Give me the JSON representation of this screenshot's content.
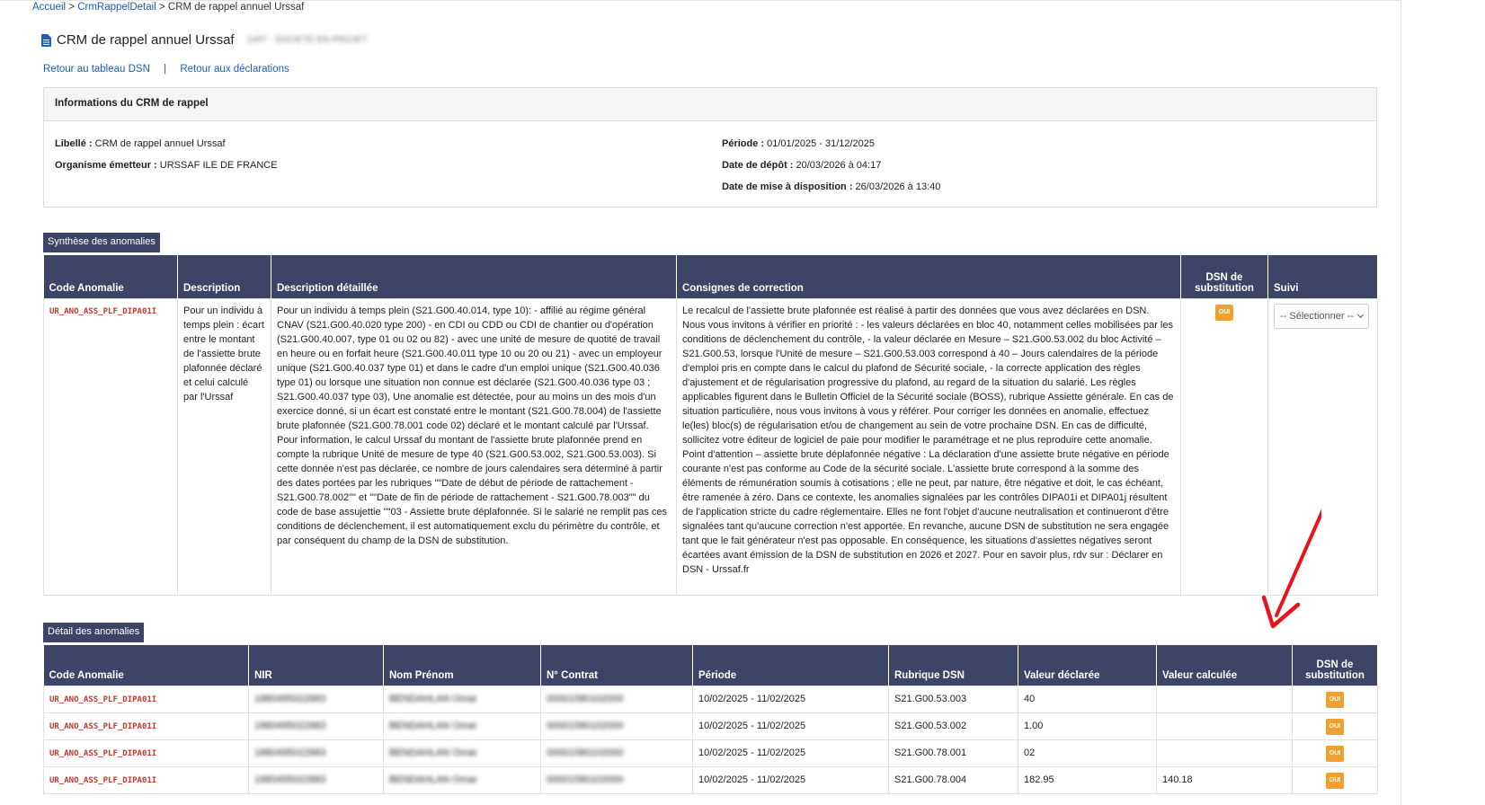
{
  "breadcrumb": {
    "home": "Accueil",
    "section": "CrmRappelDetail",
    "current": "CRM de rappel annuel Urssaf",
    "sep": ">"
  },
  "page": {
    "title": "CRM de rappel annuel Urssaf",
    "subtitle_blurred": "1407 - SOCIETE EN PROJET"
  },
  "links": {
    "back_dsn": "Retour au tableau DSN",
    "separator": "|",
    "back_declarations": "Retour aux déclarations"
  },
  "info": {
    "header": "Informations du CRM de rappel",
    "libelle_label": "Libellé :",
    "libelle_value": "CRM de rappel annuel Urssaf",
    "organisme_label": "Organisme émetteur :",
    "organisme_value": "URSSAF ILE DE FRANCE",
    "periode_label": "Période :",
    "periode_value": "01/01/2025 - 31/12/2025",
    "depot_label": "Date de dépôt :",
    "depot_value": "20/03/2026 à 04:17",
    "dispo_label": "Date de mise à disposition :",
    "dispo_value": "26/03/2026 à 13:40"
  },
  "synthese": {
    "label": "Synthèse des anomalies",
    "headers": {
      "code": "Code Anomalie",
      "description": "Description",
      "detail": "Description détaillée",
      "consignes": "Consignes de correction",
      "dsn": "DSN de substitution",
      "suivi": "Suivi"
    },
    "row": {
      "code": "UR_ANO_ASS_PLF_DIPA01I",
      "description": "Pour un individu à temps plein : écart entre le montant de l'assiette brute plafonnée déclaré et celui calculé par l'Urssaf",
      "detail": "Pour un individu à temps plein (S21.G00.40.014, type 10): - affilié au régime général CNAV (S21.G00.40.020 type 200) - en CDI ou CDD ou CDI de chantier ou d'opération (S21.G00.40.007, type 01 ou 02 ou 82) - avec une unité de mesure de quotité de travail en heure ou en forfait heure (S21.G00.40.011 type 10 ou 20 ou 21) - avec un employeur unique (S21.G00.40.037 type 01) et dans le cadre d'un emploi unique (S21.G00.40.036 type 01) ou lorsque une situation non connue est déclarée (S21.G00.40.036 type 03 ; S21.G00.40.037 type 03), Une anomalie est détectée, pour au moins un des mois d'un exercice donné, si un écart est constaté entre le montant (S21.G00.78.004) de l'assiette brute plafonnée (S21.G00.78.001 code 02) déclaré et le montant calculé par l'Urssaf. Pour information, le calcul Urssaf du montant de l'assiette brute plafonnée prend en compte la rubrique Unité de mesure de type 40 (S21.G00.53.002, S21.G00.53.003). Si cette donnée n'est pas déclarée, ce nombre de jours calendaires sera déterminé à partir des dates portées par les rubriques \"\"Date de début de période de rattachement - S21.G00.78.002\"\" et \"\"Date de fin de période de rattachement - S21.G00.78.003\"\" du code de base assujettie \"\"03 - Assiette brute déplafonnée. Si le salarié ne remplit pas ces conditions de déclenchement, il est automatiquement exclu du périmètre du contrôle, et par conséquent du champ de la DSN de substitution.",
      "consignes": "Le recalcul de l'assiette brute plafonnée est réalisé à partir des données que vous avez déclarées en DSN. Nous vous invitons à vérifier en priorité : - les valeurs déclarées en bloc 40, notamment celles mobilisées par les conditions de déclenchement du contrôle, - la valeur déclarée en Mesure – S21.G00.53.002 du bloc Activité – S21.G00.53, lorsque l'Unité de mesure – S21.G00.53.003 correspond à 40 – Jours calendaires de la période d'emploi pris en compte dans le calcul du plafond de Sécurité sociale, - la correcte application des règles d'ajustement et de régularisation progressive du plafond, au regard de la situation du salarié. Les règles applicables figurent dans le Bulletin Officiel de la Sécurité sociale (BOSS), rubrique Assiette générale. En cas de situation particulière, nous vous invitons à vous y référer. Pour corriger les données en anomalie, effectuez le(les) bloc(s) de régularisation et/ou de changement au sein de votre prochaine DSN. En cas de difficulté, sollicitez votre éditeur de logiciel de paie pour modifier le paramétrage et ne plus reproduire cette anomalie. Point d'attention – assiette brute déplafonnée négative : La déclaration d'une assiette brute négative en période courante n'est pas conforme au Code de la sécurité sociale. L'assiette brute correspond à la somme des éléments de rémunération soumis à cotisations ; elle ne peut, par nature, être négative et doit, le cas échéant, être ramenée à zéro. Dans ce contexte, les anomalies signalées par les contrôles DIPA01i et DIPA01j résultent de l'application stricte du cadre réglementaire. Elles ne font l'objet d'aucune neutralisation et continueront d'être signalées tant qu'aucune correction n'est apportée. En revanche, aucune DSN de substitution ne sera engagée tant que le fait générateur n'est pas opposable. En conséquence, les situations d'assiettes négatives seront écartées avant émission de la DSN de substitution en 2026 et 2027. Pour en savoir plus, rdv sur : Déclarer en DSN - Urssaf.fr",
      "dsn": "OUI",
      "suivi": "-- Sélectionner --"
    }
  },
  "detail": {
    "label": "Détail des anomalies",
    "headers": {
      "code": "Code Anomalie",
      "nir": "NIR",
      "nom": "Nom Prénom",
      "contrat": "N° Contrat",
      "periode": "Période",
      "rubrique": "Rubrique DSN",
      "declaree": "Valeur déclarée",
      "calculee": "Valeur calculée",
      "dsn": "DSN de substitution"
    },
    "rows": [
      {
        "code": "UR_ANO_ASS_PLF_DIPA01I",
        "nir": "1880495022883",
        "nom": "BENDAHLAN Omar",
        "contrat": "00001580102000",
        "periode": "10/02/2025 - 11/02/2025",
        "rubrique": "S21.G00.53.003",
        "declaree": "40",
        "calculee": "",
        "dsn": "OUI"
      },
      {
        "code": "UR_ANO_ASS_PLF_DIPA01I",
        "nir": "1880495022883",
        "nom": "BENDAHLAN Omar",
        "contrat": "00001580102000",
        "periode": "10/02/2025 - 11/02/2025",
        "rubrique": "S21.G00.53.002",
        "declaree": "1.00",
        "calculee": "",
        "dsn": "OUI"
      },
      {
        "code": "UR_ANO_ASS_PLF_DIPA01I",
        "nir": "1880495022883",
        "nom": "BENDAHLAN Omar",
        "contrat": "00001580102000",
        "periode": "10/02/2025 - 11/02/2025",
        "rubrique": "S21.G00.78.001",
        "declaree": "02",
        "calculee": "",
        "dsn": "OUI"
      },
      {
        "code": "UR_ANO_ASS_PLF_DIPA01I",
        "nir": "1880495022883",
        "nom": "BENDAHLAN Omar",
        "contrat": "00001580102000",
        "periode": "10/02/2025 - 11/02/2025",
        "rubrique": "S21.G00.78.004",
        "declaree": "182.95",
        "calculee": "140.18",
        "dsn": "OUI"
      }
    ]
  },
  "colors": {
    "header_bg": "#3d4466",
    "link": "#1a5fb4",
    "code": "#c0392b",
    "badge": "#f0a030",
    "arrow": "#e8141c"
  }
}
